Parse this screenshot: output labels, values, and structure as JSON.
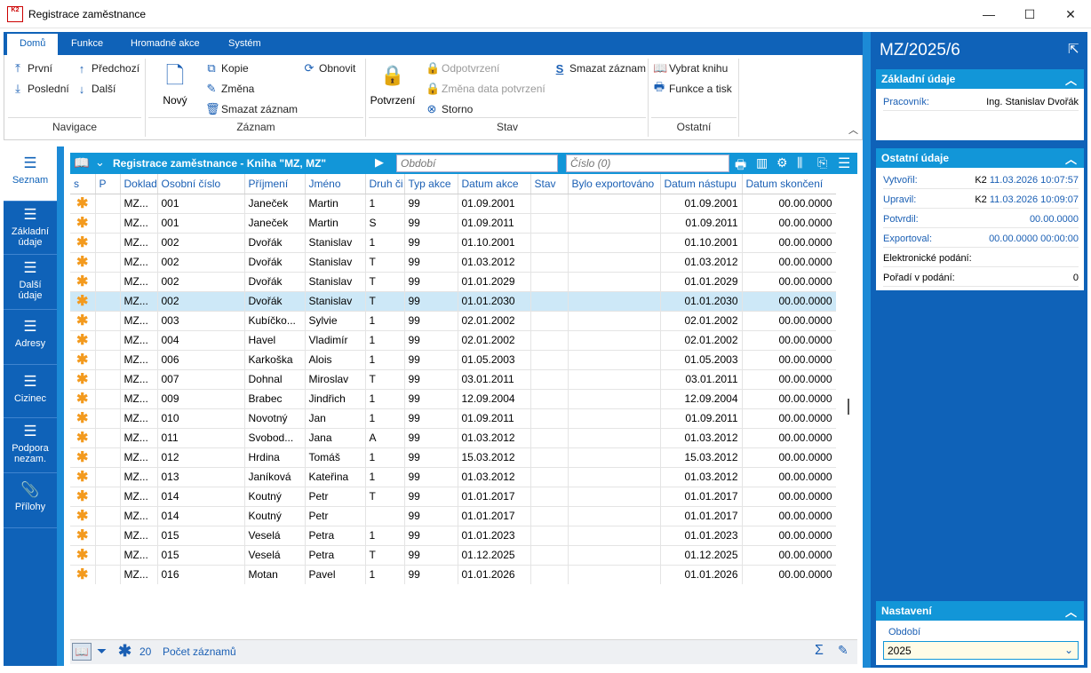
{
  "window": {
    "title": "Registrace zaměstnance",
    "icon_text": "K2",
    "minimize": "—",
    "maximize": "☐",
    "close": "✕"
  },
  "ribbon": {
    "tabs": [
      "Domů",
      "Funkce",
      "Hromadné akce",
      "Systém"
    ],
    "nav": {
      "first": "První",
      "last": "Poslední",
      "prev": "Předchozí",
      "next": "Další",
      "group": "Navigace"
    },
    "record": {
      "new": "Nový",
      "copy": "Kopie",
      "change": "Změna",
      "delete": "Smazat záznam",
      "refresh": "Obnovit",
      "group": "Záznam"
    },
    "state": {
      "confirm": "Potvrzení",
      "unconfirm": "Odpotvrzení",
      "change_date": "Změna data potvrzení",
      "storno": "Storno",
      "delete": "Smazat záznam",
      "group": "Stav"
    },
    "other": {
      "pick_book": "Vybrat knihu",
      "functions": "Funkce a tisk",
      "group": "Ostatní"
    }
  },
  "leftnav": [
    "Seznam",
    "Základní údaje",
    "Další údaje",
    "Adresy",
    "Cizinec",
    "Podpora nezam.",
    "Přílohy"
  ],
  "grid": {
    "title": "Registrace zaměstnance - Kniha \"MZ, MZ\"",
    "period_placeholder": "Období",
    "number_placeholder": "Číslo (0)",
    "columns": [
      "s",
      "P",
      "Doklad",
      "Osobní číslo",
      "Příjmení",
      "Jméno",
      "Druh či",
      "Typ akce",
      "Datum akce",
      "Stav",
      "Bylo exportováno",
      "Datum nástupu",
      "Datum skončení"
    ],
    "rows": [
      [
        "✱",
        "",
        "MZ...",
        "001",
        "Janeček",
        "Martin",
        "1",
        "99",
        "01.09.2001",
        "",
        "",
        "01.09.2001",
        "00.00.0000"
      ],
      [
        "✱",
        "",
        "MZ...",
        "001",
        "Janeček",
        "Martin",
        "S",
        "99",
        "01.09.2011",
        "",
        "",
        "01.09.2011",
        "00.00.0000"
      ],
      [
        "✱",
        "",
        "MZ...",
        "002",
        "Dvořák",
        "Stanislav",
        "1",
        "99",
        "01.10.2001",
        "",
        "",
        "01.10.2001",
        "00.00.0000"
      ],
      [
        "✱",
        "",
        "MZ...",
        "002",
        "Dvořák",
        "Stanislav",
        "T",
        "99",
        "01.03.2012",
        "",
        "",
        "01.03.2012",
        "00.00.0000"
      ],
      [
        "✱",
        "",
        "MZ...",
        "002",
        "Dvořák",
        "Stanislav",
        "T",
        "99",
        "01.01.2029",
        "",
        "",
        "01.01.2029",
        "00.00.0000"
      ],
      [
        "✱",
        "",
        "MZ...",
        "002",
        "Dvořák",
        "Stanislav",
        "T",
        "99",
        "01.01.2030",
        "",
        "",
        "01.01.2030",
        "00.00.0000"
      ],
      [
        "✱",
        "",
        "MZ...",
        "003",
        "Kubíčko...",
        "Sylvie",
        "1",
        "99",
        "02.01.2002",
        "",
        "",
        "02.01.2002",
        "00.00.0000"
      ],
      [
        "✱",
        "",
        "MZ...",
        "004",
        "Havel",
        "Vladimír",
        "1",
        "99",
        "02.01.2002",
        "",
        "",
        "02.01.2002",
        "00.00.0000"
      ],
      [
        "✱",
        "",
        "MZ...",
        "006",
        "Karkoška",
        "Alois",
        "1",
        "99",
        "01.05.2003",
        "",
        "",
        "01.05.2003",
        "00.00.0000"
      ],
      [
        "✱",
        "",
        "MZ...",
        "007",
        "Dohnal",
        "Miroslav",
        "T",
        "99",
        "03.01.2011",
        "",
        "",
        "03.01.2011",
        "00.00.0000"
      ],
      [
        "✱",
        "",
        "MZ...",
        "009",
        "Brabec",
        "Jindřich",
        "1",
        "99",
        "12.09.2004",
        "",
        "",
        "12.09.2004",
        "00.00.0000"
      ],
      [
        "✱",
        "",
        "MZ...",
        "010",
        "Novotný",
        "Jan",
        "1",
        "99",
        "01.09.2011",
        "",
        "",
        "01.09.2011",
        "00.00.0000"
      ],
      [
        "✱",
        "",
        "MZ...",
        "011",
        "Svobod...",
        "Jana",
        "A",
        "99",
        "01.03.2012",
        "",
        "",
        "01.03.2012",
        "00.00.0000"
      ],
      [
        "✱",
        "",
        "MZ...",
        "012",
        "Hrdina",
        "Tomáš",
        "1",
        "99",
        "15.03.2012",
        "",
        "",
        "15.03.2012",
        "00.00.0000"
      ],
      [
        "✱",
        "",
        "MZ...",
        "013",
        "Janíková",
        "Kateřina",
        "1",
        "99",
        "01.03.2012",
        "",
        "",
        "01.03.2012",
        "00.00.0000"
      ],
      [
        "✱",
        "",
        "MZ...",
        "014",
        "Koutný",
        "Petr",
        "T",
        "99",
        "01.01.2017",
        "",
        "",
        "01.01.2017",
        "00.00.0000"
      ],
      [
        "✱",
        "",
        "MZ...",
        "014",
        "Koutný",
        "Petr",
        "",
        "99",
        "01.01.2017",
        "",
        "",
        "01.01.2017",
        "00.00.0000"
      ],
      [
        "✱",
        "",
        "MZ...",
        "015",
        "Veselá",
        "Petra",
        "1",
        "99",
        "01.01.2023",
        "",
        "",
        "01.01.2023",
        "00.00.0000"
      ],
      [
        "✱",
        "",
        "MZ...",
        "015",
        "Veselá",
        "Petra",
        "T",
        "99",
        "01.12.2025",
        "",
        "",
        "01.12.2025",
        "00.00.0000"
      ],
      [
        "✱",
        "",
        "MZ...",
        "016",
        "Motan",
        "Pavel",
        "1",
        "99",
        "01.01.2026",
        "",
        "",
        "01.01.2026",
        "00.00.0000"
      ]
    ],
    "selected_row": 5,
    "count": "20",
    "count_label": "Počet záznamů"
  },
  "right": {
    "title": "MZ/2025/6",
    "basic": {
      "header": "Základní údaje",
      "employee_label": "Pracovník:",
      "employee": "Ing. Stanislav Dvořák"
    },
    "other": {
      "header": "Ostatní údaje",
      "created_label": "Vytvořil:",
      "created_user": "K2",
      "created": "11.03.2026 10:07:57",
      "modified_label": "Upravil:",
      "modified_user": "K2",
      "modified": "11.03.2026 10:09:07",
      "confirmed_label": "Potvrdil:",
      "confirmed": "00.00.0000",
      "exported_label": "Exportoval:",
      "exported": "00.00.0000 00:00:00",
      "efiling_label": "Elektronické podání:",
      "order_label": "Pořadí v podání:",
      "order": "0"
    },
    "settings": {
      "header": "Nastavení",
      "period_label": "Období",
      "period": "2025"
    }
  }
}
